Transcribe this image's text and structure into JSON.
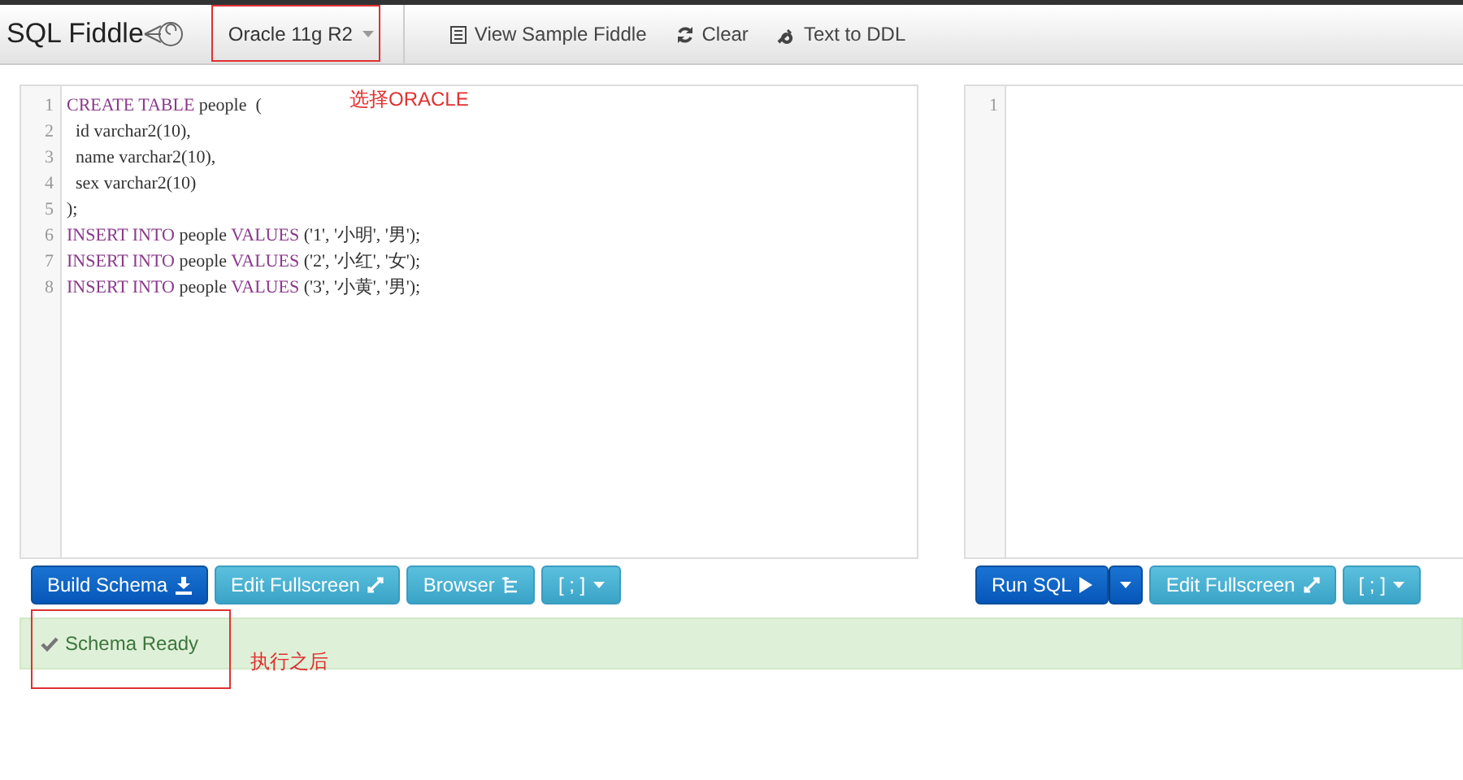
{
  "navbar": {
    "brand": "SQL Fiddle",
    "database_dropdown": "Oracle 11g R2",
    "links": [
      {
        "kind": "sample",
        "label": "View Sample Fiddle"
      },
      {
        "kind": "clear",
        "label": "Clear"
      },
      {
        "kind": "ddl",
        "label": "Text to DDL"
      }
    ]
  },
  "schema_editor": {
    "lines": [
      {
        "number": "1",
        "segments": [
          {
            "kind": "keyword",
            "text": "CREATE TABLE"
          },
          {
            "kind": "text",
            "text": " people  ("
          }
        ]
      },
      {
        "number": "2",
        "segments": [
          {
            "kind": "text",
            "text": "  id varchar2(10),"
          }
        ]
      },
      {
        "number": "3",
        "segments": [
          {
            "kind": "text",
            "text": "  name varchar2(10),"
          }
        ]
      },
      {
        "number": "4",
        "segments": [
          {
            "kind": "text",
            "text": "  sex varchar2(10)"
          }
        ]
      },
      {
        "number": "5",
        "segments": [
          {
            "kind": "text",
            "text": ");"
          }
        ]
      },
      {
        "number": "6",
        "segments": [
          {
            "kind": "keyword",
            "text": "INSERT INTO"
          },
          {
            "kind": "text",
            "text": " people "
          },
          {
            "kind": "keyword",
            "text": "VALUES"
          },
          {
            "kind": "text",
            "text": " ('1', '小明', '男');"
          }
        ]
      },
      {
        "number": "7",
        "segments": [
          {
            "kind": "keyword",
            "text": "INSERT INTO"
          },
          {
            "kind": "text",
            "text": " people "
          },
          {
            "kind": "keyword",
            "text": "VALUES"
          },
          {
            "kind": "text",
            "text": " ('2', '小红', '女');"
          }
        ]
      },
      {
        "number": "8",
        "segments": [
          {
            "kind": "keyword",
            "text": "INSERT INTO"
          },
          {
            "kind": "text",
            "text": " people "
          },
          {
            "kind": "keyword",
            "text": "VALUES"
          },
          {
            "kind": "text",
            "text": " ('3', '小黄', '男');"
          }
        ]
      }
    ]
  },
  "schema_buttons": [
    {
      "kind": "build",
      "label": "Build Schema"
    },
    {
      "kind": "fullscreen",
      "label": "Edit Fullscreen"
    },
    {
      "kind": "browser",
      "label": "Browser"
    },
    {
      "kind": "delimiter",
      "label": "[ ; ]"
    }
  ],
  "query_editor": {
    "lines": [
      {
        "number": "1"
      }
    ]
  },
  "query_buttons": [
    {
      "kind": "run",
      "label": "Run SQL"
    },
    {
      "kind": "run-options"
    },
    {
      "kind": "fullscreen",
      "label": "Edit Fullscreen"
    },
    {
      "kind": "delimiter",
      "label": "[ ; ]"
    }
  ],
  "status": {
    "message": "Schema Ready"
  },
  "annotations": [
    {
      "kind": "dropdown",
      "text": "选择ORACLE"
    },
    {
      "kind": "status",
      "text": "执行之后"
    }
  ]
}
